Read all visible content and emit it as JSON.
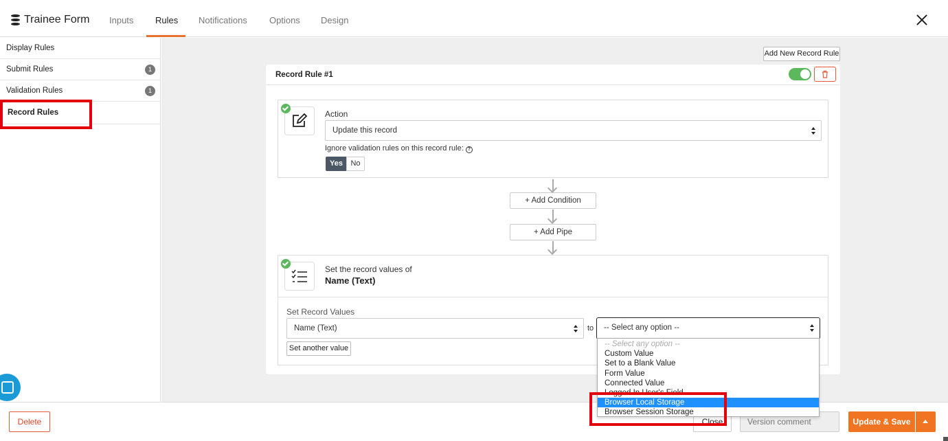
{
  "header": {
    "title": "Trainee Form",
    "tabs": [
      {
        "label": "Inputs"
      },
      {
        "label": "Rules"
      },
      {
        "label": "Notifications"
      },
      {
        "label": "Options"
      },
      {
        "label": "Design"
      }
    ],
    "active_tab": "Rules"
  },
  "sidebar": {
    "items": [
      {
        "label": "Display Rules",
        "badge": ""
      },
      {
        "label": "Submit Rules",
        "badge": "1"
      },
      {
        "label": "Validation Rules",
        "badge": "1"
      },
      {
        "label": "Record Rules",
        "badge": ""
      }
    ],
    "active_item": "Record Rules"
  },
  "main": {
    "add_rule_label": "Add New Record Rule",
    "rule": {
      "title": "Record Rule #1",
      "enabled": true,
      "action": {
        "label": "Action",
        "selected": "Update this record",
        "ignore_label": "Ignore validation rules on this record rule:",
        "help_glyph": "?",
        "yes_label": "Yes",
        "no_label": "No",
        "selected_toggle": "Yes"
      },
      "add_condition_label": "Add Condition",
      "add_pipe_label": "Add Pipe",
      "set_values": {
        "intro": "Set the record values of",
        "field_name": "Name (Text)",
        "section_label": "Set Record Values",
        "field_select": "Name (Text)",
        "to_label": "to",
        "value_select": "-- Select any option --",
        "set_another_label": "Set another value"
      }
    },
    "dropdown": {
      "options": [
        "-- Select any option --",
        "Custom Value",
        "Set to a Blank Value",
        "Form Value",
        "Connected Value",
        "Logged In User's Field",
        "Browser Local Storage",
        "Browser Session Storage"
      ],
      "highlighted": "Browser Local Storage"
    }
  },
  "footer": {
    "delete_label": "Delete",
    "close_label": "Close",
    "version_placeholder": "Version comment",
    "update_label": "Update & Save"
  },
  "colors": {
    "accent": "#f07422",
    "tab_underline": "#e8712b",
    "toggle_on": "#5cb85c",
    "highlight_box": "#e3000b",
    "dropdown_selected": "#1e90ff",
    "delete": "#d9472b"
  },
  "icons": {
    "app": "database-icon",
    "close": "close-icon",
    "trash": "trash-icon",
    "action": "edit-icon",
    "values": "checklist-icon",
    "plus": "plus-icon",
    "chat": "chat-icon"
  }
}
